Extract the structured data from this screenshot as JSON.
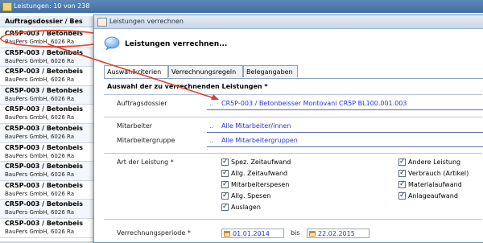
{
  "background": {
    "title": "Leistungen: 10 von 238",
    "column_header": "Auftragsdossier / Bes",
    "items": [
      {
        "line1": "CR5P-003 / Betonbeis",
        "line2": "BauPers GmbH, 6026 Ra"
      },
      {
        "line1": "CR5P-003 / Betonbeis",
        "line2": "BauPers GmbH, 6026 Ra"
      },
      {
        "line1": "CR5P-003 / Betonbeis",
        "line2": "BauPers GmbH, 6026 Ra"
      },
      {
        "line1": "CR5P-003 / Betonbeis",
        "line2": "BauPers GmbH, 6026 Ra"
      },
      {
        "line1": "CR5P-003 / Betonbeis",
        "line2": "BauPers GmbH, 6026 Ra"
      },
      {
        "line1": "CR5P-003 / Betonbeis",
        "line2": "BauPers GmbH, 6026 Ra"
      },
      {
        "line1": "CR5P-003 / Betonbeis",
        "line2": "BauPers GmbH, 6026 Ra"
      },
      {
        "line1": "CR5P-003 / Betonbeis",
        "line2": "BauPers GmbH, 6026 Ra"
      },
      {
        "line1": "CR5P-003 / Betonbeis",
        "line2": "BauPers GmbH, 6026 Ra"
      },
      {
        "line1": "CR5P-003 / Betonbeis",
        "line2": "BauPers GmbH, 6026 Ra"
      },
      {
        "line1": "CR5P-003 / Betonbeis",
        "line2": "BauPers GmbH, 6026 Ra"
      }
    ]
  },
  "dialog": {
    "title": "Leistungen verrechnen",
    "heading": "Leistungen verrechnen...",
    "tabs": [
      "Auswahlkriterien",
      "Verrechnungsregeln",
      "Belegangaben"
    ],
    "section_title": "Auswahl der zu verrechnenden Leistungen *",
    "fields": {
      "auftragsdossier": {
        "label": "Auftragsdossier",
        "dots": "..",
        "value": "CR5P-003 / Betonbeisser Montovani CR5P BL100.001.003"
      },
      "mitarbeiter": {
        "label": "Mitarbeiter",
        "dots": "..",
        "value": "Alle Mitarbeiter/innen"
      },
      "mitarbeitergruppe": {
        "label": "Mitarbeitergruppe",
        "dots": "..",
        "value": "Alle Mitarbeitergruppen"
      }
    },
    "art_label": "Art der Leistung *",
    "checkboxes_left": [
      {
        "label": "Spez. Zeitaufwand",
        "checked": true
      },
      {
        "label": "Allg. Zeitaufwand",
        "checked": true
      },
      {
        "label": "Mitarbeiterspesen",
        "checked": true
      },
      {
        "label": "Allg. Spesen",
        "checked": true
      },
      {
        "label": "Auslagen",
        "checked": true
      }
    ],
    "checkboxes_right": [
      {
        "label": "Andere Leistung",
        "checked": true
      },
      {
        "label": "Verbrauch (Artikel)",
        "checked": true
      },
      {
        "label": "Materialaufwand",
        "checked": true
      },
      {
        "label": "Anlageaufwand",
        "checked": true
      }
    ],
    "periode": {
      "label": "Verrechnungsperiode *",
      "from": "01.01.2014",
      "bis_label": "bis",
      "to": "22.02.2015"
    }
  },
  "colors": {
    "highlight": "#e04a35",
    "link_value": "#2a34d8"
  }
}
